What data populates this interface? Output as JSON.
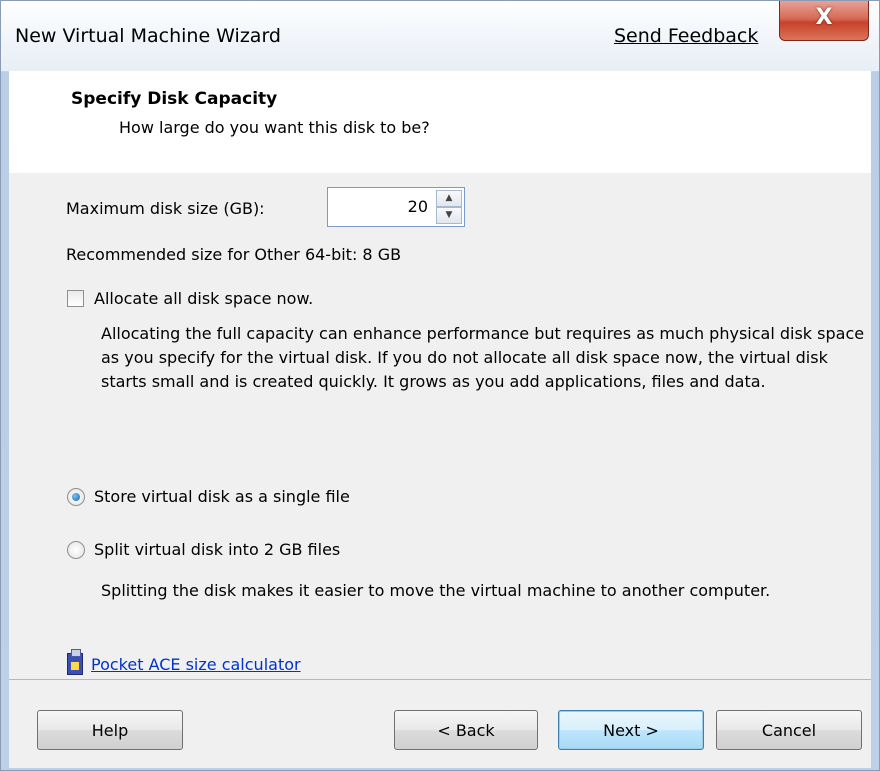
{
  "window": {
    "title": "New Virtual Machine Wizard",
    "feedback_link": "Send Feedback",
    "close_glyph": "X"
  },
  "header": {
    "title": "Specify Disk Capacity",
    "subtitle": "How large do you want this disk to be?"
  },
  "disk": {
    "size_label": "Maximum disk size (GB):",
    "size_value": "20",
    "recommended": "Recommended size for Other 64-bit: 8 GB"
  },
  "allocate": {
    "label": "Allocate all disk space now.",
    "checked": false,
    "description": "Allocating the full capacity can enhance performance but requires as much physical disk space as you specify for the virtual disk. If you do not allocate all disk space now, the virtual disk starts small and is created quickly. It grows as you add applications, files and data."
  },
  "storage": {
    "single_file_label": "Store virtual disk as a single file",
    "split_label": "Split virtual disk into 2 GB files",
    "selected": "single",
    "split_description": "Splitting the disk makes it easier to move the virtual machine to another computer."
  },
  "pocket_ace": {
    "link": "Pocket ACE size calculator",
    "icon": "usb-drive-icon"
  },
  "buttons": {
    "help": "Help",
    "back": "< Back",
    "next": "Next >",
    "cancel": "Cancel"
  },
  "colors": {
    "link": "#0033cc",
    "close_button": "#c8412a",
    "default_button_border": "#3c7fb1"
  }
}
